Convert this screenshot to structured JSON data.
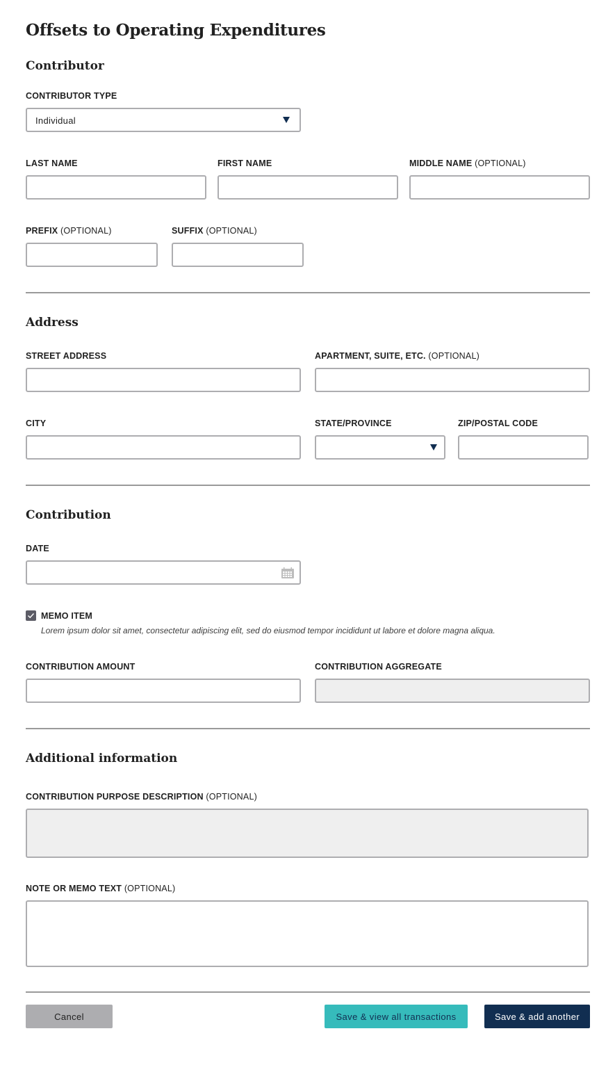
{
  "page": {
    "title": "Offsets to Operating Expenditures"
  },
  "contributor": {
    "heading": "Contributor",
    "contributor_type": {
      "label": "CONTRIBUTOR TYPE",
      "value": "Individual"
    },
    "last_name": {
      "label": "LAST NAME",
      "value": ""
    },
    "first_name": {
      "label": "FIRST NAME",
      "value": ""
    },
    "middle_name": {
      "label": "MIDDLE NAME",
      "optional": "(OPTIONAL)",
      "value": ""
    },
    "prefix": {
      "label": "PREFIX",
      "optional": "(OPTIONAL)",
      "value": ""
    },
    "suffix": {
      "label": "SUFFIX",
      "optional": "(OPTIONAL)",
      "value": ""
    }
  },
  "address": {
    "heading": "Address",
    "street": {
      "label": "STREET ADDRESS",
      "value": ""
    },
    "apartment": {
      "label": "APARTMENT, SUITE, ETC.",
      "optional": "(OPTIONAL)",
      "value": ""
    },
    "city": {
      "label": "CITY",
      "value": ""
    },
    "state": {
      "label": "STATE/PROVINCE",
      "value": ""
    },
    "zip": {
      "label": "ZIP/POSTAL CODE",
      "value": ""
    }
  },
  "contribution": {
    "heading": "Contribution",
    "date": {
      "label": "DATE",
      "value": "",
      "icon": "calendar-icon"
    },
    "memo_item": {
      "label": "MEMO ITEM",
      "checked": true,
      "description": "Lorem ipsum dolor sit amet, consectetur adipiscing elit, sed do eiusmod tempor incididunt ut labore et dolore magna aliqua."
    },
    "amount": {
      "label": "CONTRIBUTION AMOUNT",
      "value": ""
    },
    "aggregate": {
      "label": "CONTRIBUTION AGGREGATE",
      "value": ""
    }
  },
  "additional": {
    "heading": "Additional information",
    "purpose": {
      "label": "CONTRIBUTION PURPOSE DESCRIPTION",
      "optional": "(OPTIONAL)",
      "value": ""
    },
    "note": {
      "label": "NOTE OR MEMO TEXT",
      "optional": "(OPTIONAL)",
      "value": ""
    }
  },
  "actions": {
    "cancel": "Cancel",
    "save_view": "Save & view all transactions",
    "save_add": "Save & add another"
  },
  "colors": {
    "primary": "#112e51",
    "secondary": "#36bbbb",
    "neutral_button": "#adadb0",
    "border": "#adadb0",
    "disabled_bg": "#efefef"
  }
}
